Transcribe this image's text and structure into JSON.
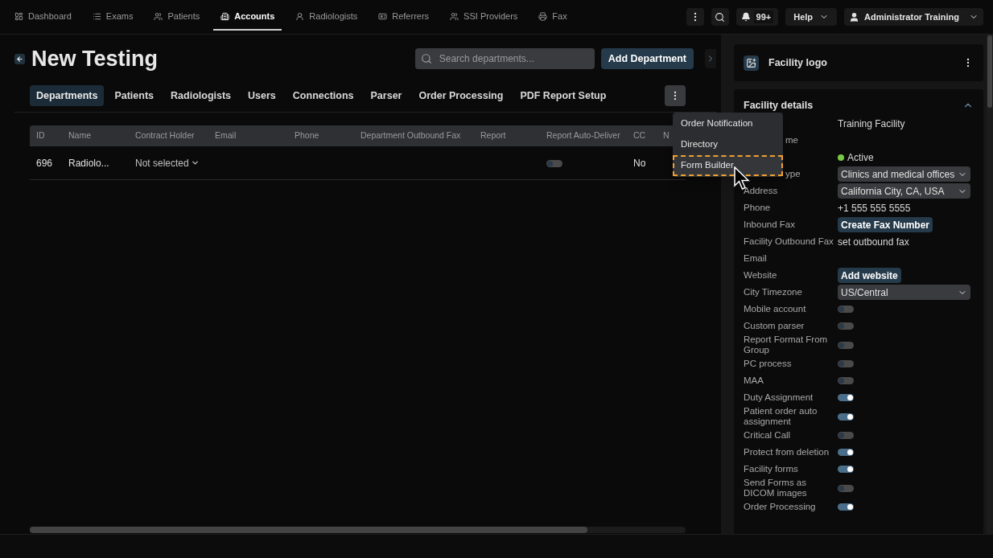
{
  "nav": {
    "items": [
      {
        "label": "Dashboard",
        "selected": false
      },
      {
        "label": "Exams",
        "selected": false
      },
      {
        "label": "Patients",
        "selected": false
      },
      {
        "label": "Accounts",
        "selected": true
      },
      {
        "label": "Radiologists",
        "selected": false
      },
      {
        "label": "Referrers",
        "selected": false
      },
      {
        "label": "SSI Providers",
        "selected": false
      },
      {
        "label": "Fax",
        "selected": false
      }
    ],
    "notifications": "99+",
    "help": "Help",
    "user": "Administrator Training"
  },
  "page": {
    "title": "New Testing",
    "search": {
      "placeholder": "Search departments..."
    },
    "add_button": "Add Department"
  },
  "tabs": [
    {
      "label": "Departments",
      "selected": true
    },
    {
      "label": "Patients",
      "selected": false
    },
    {
      "label": "Radiologists",
      "selected": false
    },
    {
      "label": "Users",
      "selected": false
    },
    {
      "label": "Connections",
      "selected": false
    },
    {
      "label": "Parser",
      "selected": false
    },
    {
      "label": "Order Processing",
      "selected": false
    },
    {
      "label": "PDF Report Setup",
      "selected": false
    }
  ],
  "table": {
    "columns": [
      "ID",
      "Name",
      "Contract Holder",
      "Email",
      "Phone",
      "Department Outbound Fax",
      "Report",
      "Report Auto-Deliver",
      "CC",
      "N"
    ],
    "rows": [
      {
        "id": "696",
        "name": "Radiolo...",
        "contract_holder": "Not selected",
        "auto_delivery": false,
        "cc": "No"
      }
    ]
  },
  "menu": {
    "items": [
      {
        "label": "Order Notification",
        "selected": false
      },
      {
        "label": "Directory",
        "selected": false
      },
      {
        "label": "Form Builder",
        "selected": true
      }
    ]
  },
  "panel": {
    "logo_title": "Facility logo",
    "details_title": "Facility details",
    "expanded": true,
    "fields": [
      {
        "kind": "text",
        "value": "Training Facility"
      },
      {
        "kind": "text",
        "label": "me",
        "partial_label": true
      },
      {
        "kind": "status",
        "value": "Active",
        "color": "#7ac943"
      },
      {
        "kind": "select",
        "label": "ype",
        "partial_label": true,
        "value": "Clinics and medical offices"
      },
      {
        "kind": "select",
        "label": "Address",
        "value": "California City, CA, USA"
      },
      {
        "kind": "text",
        "label": "Phone",
        "value": "+1 555 555 5555"
      },
      {
        "kind": "button",
        "label": "Inbound Fax",
        "value": "Create Fax Number"
      },
      {
        "kind": "text",
        "label": "Facility Outbound Fax",
        "value": "set outbound fax"
      },
      {
        "kind": "text",
        "label": "Email"
      },
      {
        "kind": "button",
        "label": "Website",
        "value": "Add website"
      },
      {
        "kind": "select",
        "label": "City Timezone",
        "value": "US/Central"
      },
      {
        "kind": "toggle",
        "label": "Mobile account",
        "on": false
      },
      {
        "kind": "toggle",
        "label": "Custom parser",
        "on": false
      },
      {
        "kind": "toggle",
        "label": "Report Format From Group",
        "on": false
      },
      {
        "kind": "toggle",
        "label": "PC process",
        "on": false
      },
      {
        "kind": "toggle",
        "label": "MAA",
        "on": false
      },
      {
        "kind": "toggle",
        "label": "Duty Assignment",
        "on": true
      },
      {
        "kind": "toggle",
        "label": "Patient order auto assignment",
        "on": true
      },
      {
        "kind": "toggle",
        "label": "Critical Call",
        "on": false
      },
      {
        "kind": "toggle",
        "label": "Protect from deletion",
        "on": true
      },
      {
        "kind": "toggle",
        "label": "Facility forms",
        "on": true
      },
      {
        "kind": "toggle",
        "label": "Send Forms as DICOM images",
        "on": false
      },
      {
        "kind": "toggle",
        "label": "Order Processing",
        "on": true
      }
    ]
  }
}
